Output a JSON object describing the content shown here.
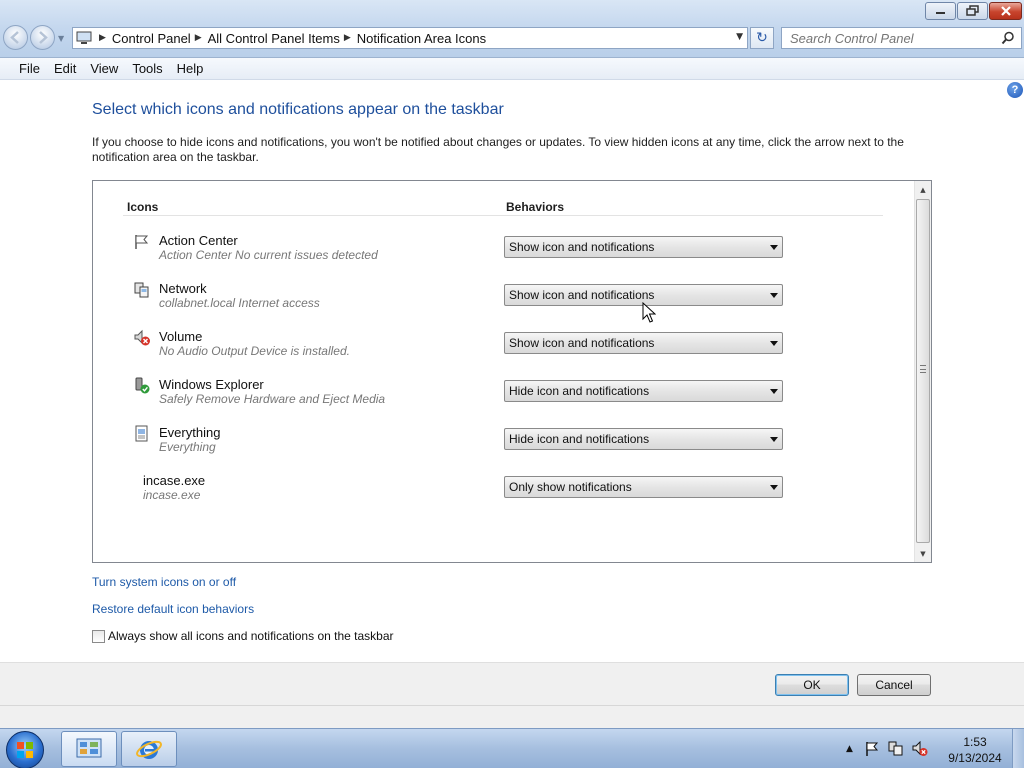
{
  "window": {
    "breadcrumb": [
      "Control Panel",
      "All Control Panel Items",
      "Notification Area Icons"
    ],
    "search_placeholder": "Search Control Panel"
  },
  "menu": {
    "items": [
      {
        "label": "File"
      },
      {
        "label": "Edit"
      },
      {
        "label": "View"
      },
      {
        "label": "Tools"
      },
      {
        "label": "Help"
      }
    ]
  },
  "main": {
    "heading": "Select which icons and notifications appear on the taskbar",
    "description": "If you choose to hide icons and notifications, you won't be notified about changes or updates. To view hidden icons at any time, click the arrow next to the notification area on the taskbar.",
    "columns": {
      "icons": "Icons",
      "behaviors": "Behaviors"
    },
    "rows": [
      {
        "name": "Action Center",
        "subtitle": "Action Center  No current issues detected",
        "behavior": "Show icon and notifications",
        "icon": "flag-icon"
      },
      {
        "name": "Network",
        "subtitle": "collabnet.local Internet access",
        "behavior": "Show icon and notifications",
        "icon": "network-icon"
      },
      {
        "name": "Volume",
        "subtitle": "No Audio Output Device is installed.",
        "behavior": "Show icon and notifications",
        "icon": "volume-muted-icon"
      },
      {
        "name": "Windows Explorer",
        "subtitle": "Safely Remove Hardware and Eject Media",
        "behavior": "Hide icon and notifications",
        "icon": "safely-remove-icon"
      },
      {
        "name": "Everything",
        "subtitle": "Everything",
        "behavior": "Hide icon and notifications",
        "icon": "everything-icon"
      },
      {
        "name": "incase.exe",
        "subtitle": "incase.exe",
        "behavior": "Only show notifications",
        "icon": ""
      }
    ],
    "links": {
      "system_icons": "Turn system icons on or off",
      "restore": "Restore default icon behaviors"
    },
    "always_show": {
      "label": "Always show all icons and notifications on the taskbar",
      "checked": false
    }
  },
  "footer": {
    "ok": "OK",
    "cancel": "Cancel"
  },
  "taskbar": {
    "time": "1:53",
    "date": "9/13/2024"
  },
  "colors": {
    "heading": "#1e4f9c",
    "link": "#1e5aa8",
    "taskbar": "#a6bfdf"
  }
}
